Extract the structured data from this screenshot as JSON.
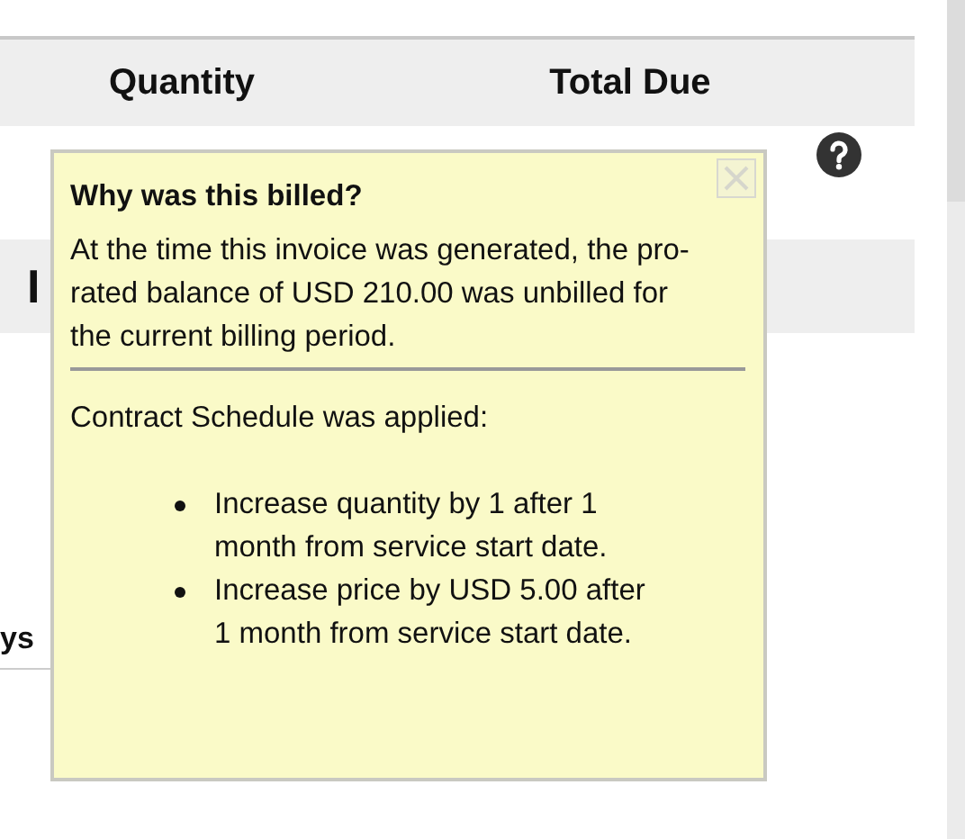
{
  "table": {
    "columns": [
      "Quantity",
      "Total Due"
    ],
    "rows": [
      {
        "help": true
      },
      {
        "heading": "I"
      }
    ]
  },
  "lower_table": {
    "header": "ys"
  },
  "popup": {
    "title": "Why was this billed?",
    "message": "At the time this invoice was generated, the pro-rated balance of USD 210.00 was unbilled for the current billing period.",
    "schedule_title": "Contract Schedule was applied:",
    "items": [
      "Increase quantity by 1 after 1 month from service start date.",
      "Increase price by USD 5.00 after 1 month from service start date."
    ]
  }
}
